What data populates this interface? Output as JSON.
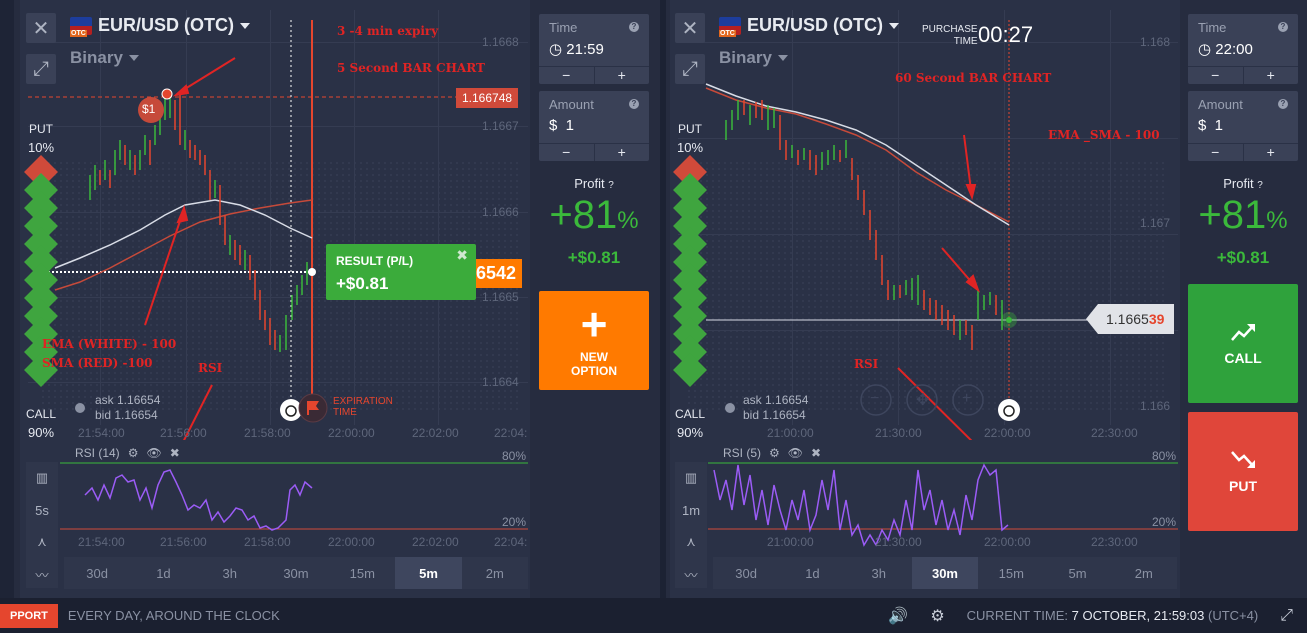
{
  "left": {
    "pair": "EUR/USD (OTC)",
    "flag_badge": "OTC",
    "mode": "Binary",
    "put_label": "PUT",
    "put_pct": "10%",
    "call_label": "CALL",
    "call_pct": "90%",
    "strike_price": "1.166748",
    "current_price": "6542",
    "y_ticks": [
      "1.1668",
      "1.1667",
      "1.1666",
      "1.1665",
      "1.1664"
    ],
    "x_ticks": [
      "21:54:00",
      "21:56:00",
      "21:58:00",
      "22:00:00",
      "22:02:00",
      "22:04:"
    ],
    "ask": "ask 1.16654",
    "bid": "bid 1.16654",
    "bet_badge": "$1",
    "expiration_label_1": "EXPIRATION",
    "expiration_label_2": "TIME",
    "result_title": "RESULT (P/L)",
    "result_value": "+$0.81",
    "rsi_label": "RSI (14)",
    "rsi_80": "80%",
    "rsi_20": "20%",
    "tool_interval": "5s",
    "timeframes": [
      "30d",
      "1d",
      "3h",
      "30m",
      "15m",
      "5m",
      "2m"
    ],
    "active_timeframe": "5m",
    "annotations": {
      "expiry": "3 -4 min expiry",
      "bar_chart": "5 Second BAR CHART",
      "ema": "EMA (WHITE) - 100",
      "sma": "SMA (RED) -100",
      "rsi": "RSI"
    },
    "time_panel": {
      "label": "Time",
      "value": "21:59"
    },
    "amount_panel": {
      "label": "Amount",
      "value": "$  1"
    },
    "profit_label": "Profit",
    "profit_pct": "+81",
    "profit_pct_sign": "%",
    "profit_usd": "+$0.81",
    "new_option": [
      "NEW",
      "OPTION"
    ]
  },
  "right": {
    "pair": "EUR/USD (OTC)",
    "flag_badge": "OTC",
    "mode": "Binary",
    "purchase_label_1": "PURCHASE",
    "purchase_label_2": "TIME",
    "purchase_time": "00:27",
    "put_label": "PUT",
    "put_pct": "10%",
    "call_label": "CALL",
    "call_pct": "90%",
    "price_prefix": "1.1665",
    "price_suffix": "39",
    "y_ticks": [
      "1.168",
      "1.167",
      "1.166"
    ],
    "x_ticks": [
      "21:00:00",
      "21:30:00",
      "22:00:00",
      "22:30:00"
    ],
    "ask": "ask 1.16654",
    "bid": "bid 1.16654",
    "rsi_label": "RSI (5)",
    "rsi_80": "80%",
    "rsi_20": "20%",
    "tool_interval": "1m",
    "timeframes": [
      "30d",
      "1d",
      "3h",
      "30m",
      "15m",
      "5m",
      "2m"
    ],
    "active_timeframe": "30m",
    "annotations": {
      "bar_chart": "60 Second BAR CHART",
      "ema_sma": "EMA _SMA - 100",
      "rsi": "RSI"
    },
    "time_panel": {
      "label": "Time",
      "value": "22:00"
    },
    "amount_panel": {
      "label": "Amount",
      "value": "$  1"
    },
    "profit_label": "Profit",
    "profit_pct": "+81",
    "profit_pct_sign": "%",
    "profit_usd": "+$0.81",
    "call_button": "CALL",
    "put_button": "PUT"
  },
  "footer": {
    "support": "PPORT",
    "tagline": "EVERY DAY, AROUND THE CLOCK",
    "current_time_label": "CURRENT TIME:",
    "current_time_value": "7 OCTOBER, 21:59:03",
    "timezone": "(UTC+4)"
  },
  "colors": {
    "green": "#3bb93b",
    "red": "#e5462e",
    "orange": "#ff7a00",
    "annotation_red": "#e02424",
    "rsi_purple": "#9b5cf6"
  }
}
